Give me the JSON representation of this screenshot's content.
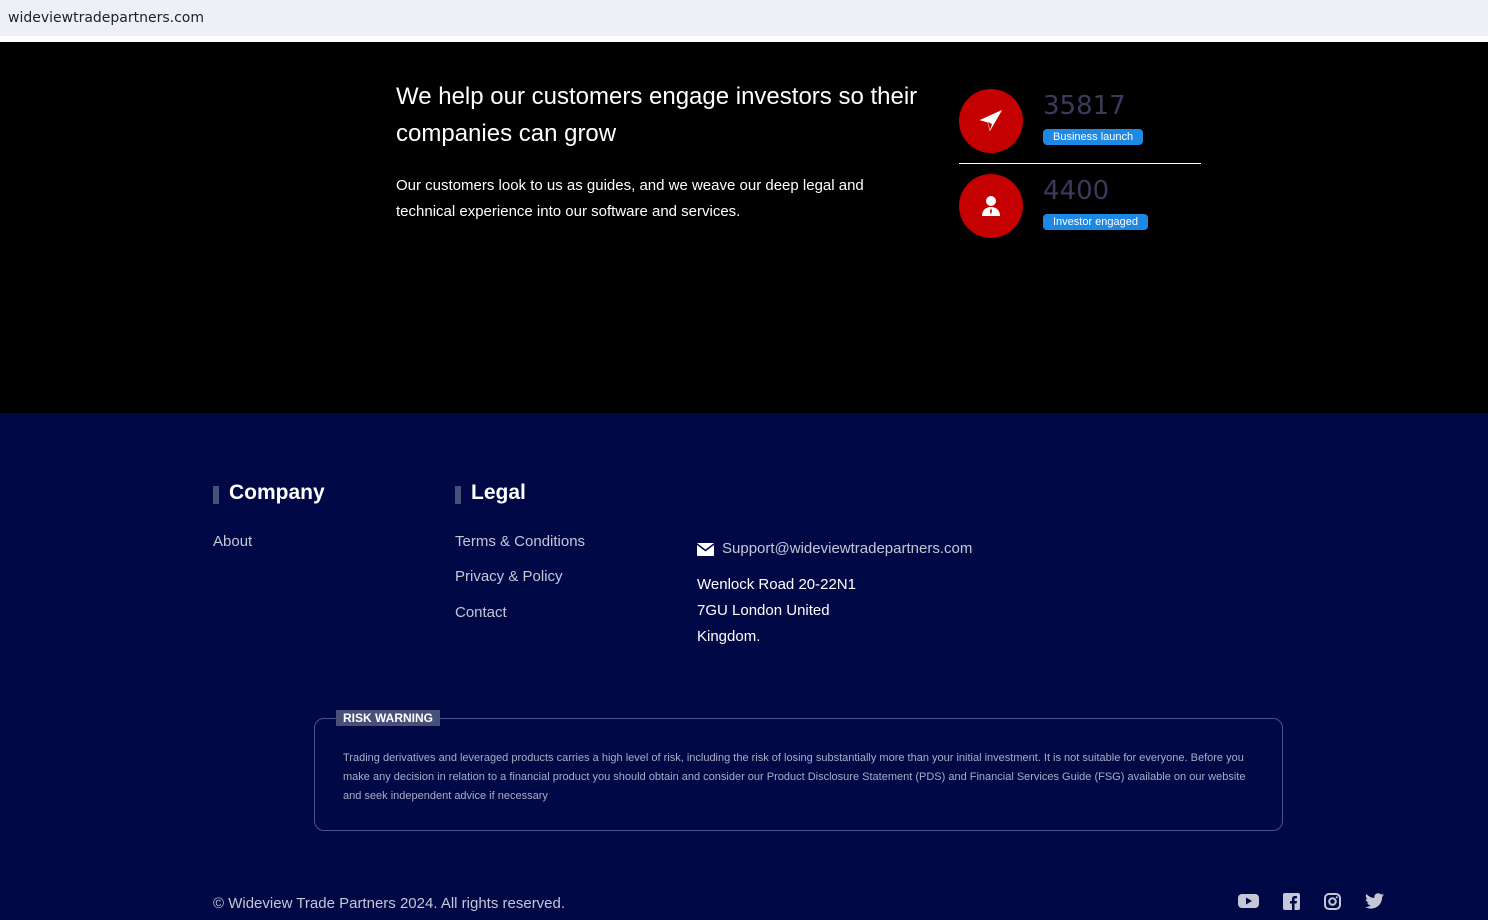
{
  "browser": {
    "url": "wideviewtradepartners.com"
  },
  "hero": {
    "heading": "We help our customers engage investors so their companies can grow",
    "paragraph": "Our customers look to us as guides, and we weave our deep legal and technical experience into our software and services.",
    "stats": [
      {
        "value": "35817",
        "label": "Business launch",
        "icon": "paper-plane-icon"
      },
      {
        "value": "4400",
        "label": "Investor engaged",
        "icon": "user-tie-icon"
      }
    ]
  },
  "footer": {
    "company": {
      "title": "Company",
      "links": [
        "About"
      ]
    },
    "legal": {
      "title": "Legal",
      "links": [
        "Terms & Conditions",
        "Privacy & Policy",
        "Contact"
      ]
    },
    "contact": {
      "email": "Support@wideviewtradepartners.com",
      "address_lines": [
        "Wenlock Road 20-22N1",
        "7GU London United",
        "Kingdom."
      ]
    },
    "risk": {
      "label": "RISK WARNING",
      "text": "Trading derivatives and leveraged products carries a high level of risk, including the risk of losing substantially more than your initial investment. It is not suitable for everyone. Before you make any decision in relation to a financial product you should obtain and consider our Product Disclosure Statement (PDS) and Financial Services Guide (FSG) available on our website and seek independent advice if necessary"
    },
    "copyright": "© Wideview Trade Partners 2024. All rights reserved.",
    "social_icons": [
      "youtube-icon",
      "facebook-icon",
      "instagram-icon",
      "twitter-icon"
    ]
  },
  "colors": {
    "accent": "#c40000",
    "badge": "#1e88e5",
    "footer_bg": "#010846"
  }
}
